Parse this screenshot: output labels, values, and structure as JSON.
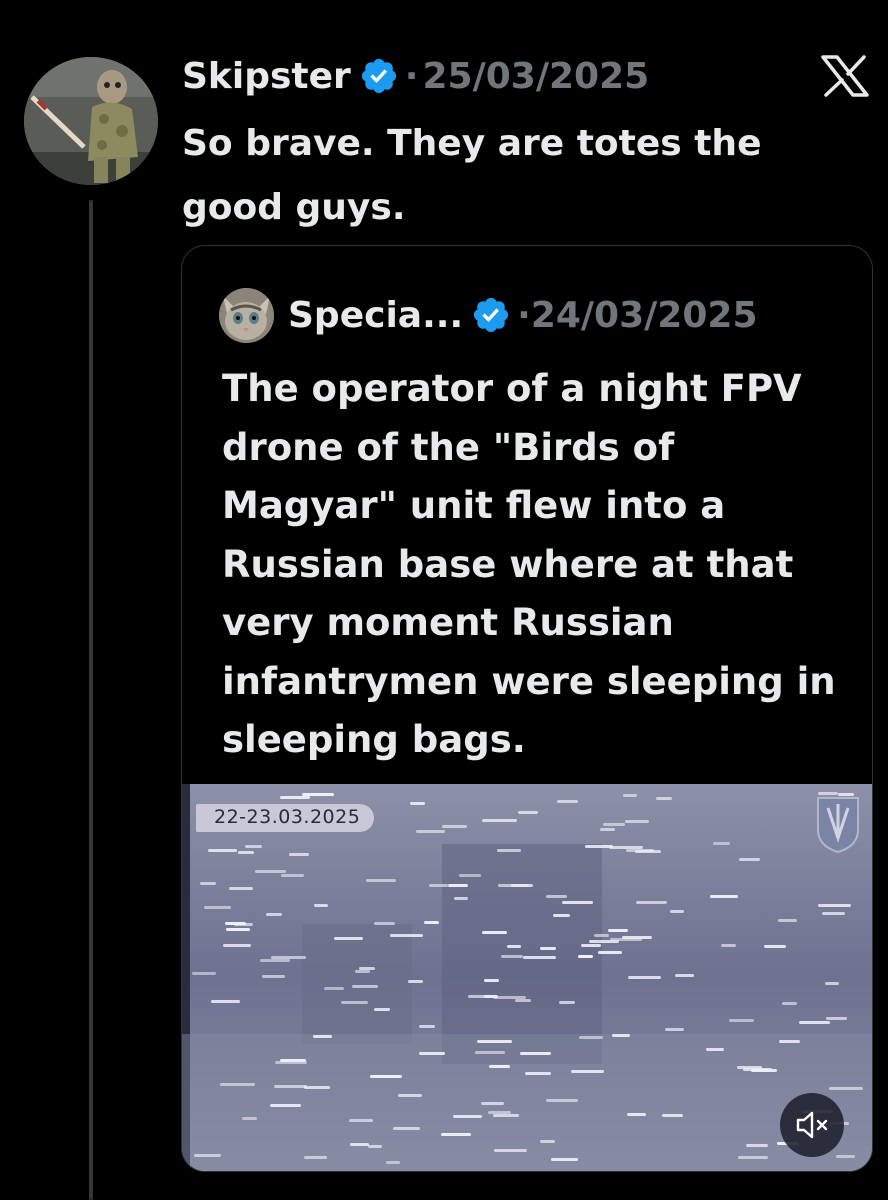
{
  "post": {
    "author_name": "Skipster",
    "separator": "·",
    "date": "25/03/2025",
    "text": "So brave. They are totes the good guys."
  },
  "quoted_post": {
    "author_name": "Specia...",
    "separator": "·",
    "date": "24/03/2025",
    "text": "The operator of a night FPV drone of the \"Birds of Magyar\" unit flew into a Russian base where at that very moment Russian infantrymen were sleeping in sleeping bags.",
    "video": {
      "date_overlay": "22-23.03.2025",
      "mute_icon": "speaker-muted-icon"
    }
  },
  "icons": {
    "verified": "verified-badge-icon",
    "platform": "x-logo-icon"
  },
  "colors": {
    "background": "#000000",
    "text_primary": "#e7e9ea",
    "text_secondary": "#71767b",
    "verified_blue": "#1d9bf0",
    "border": "#2f3336"
  }
}
